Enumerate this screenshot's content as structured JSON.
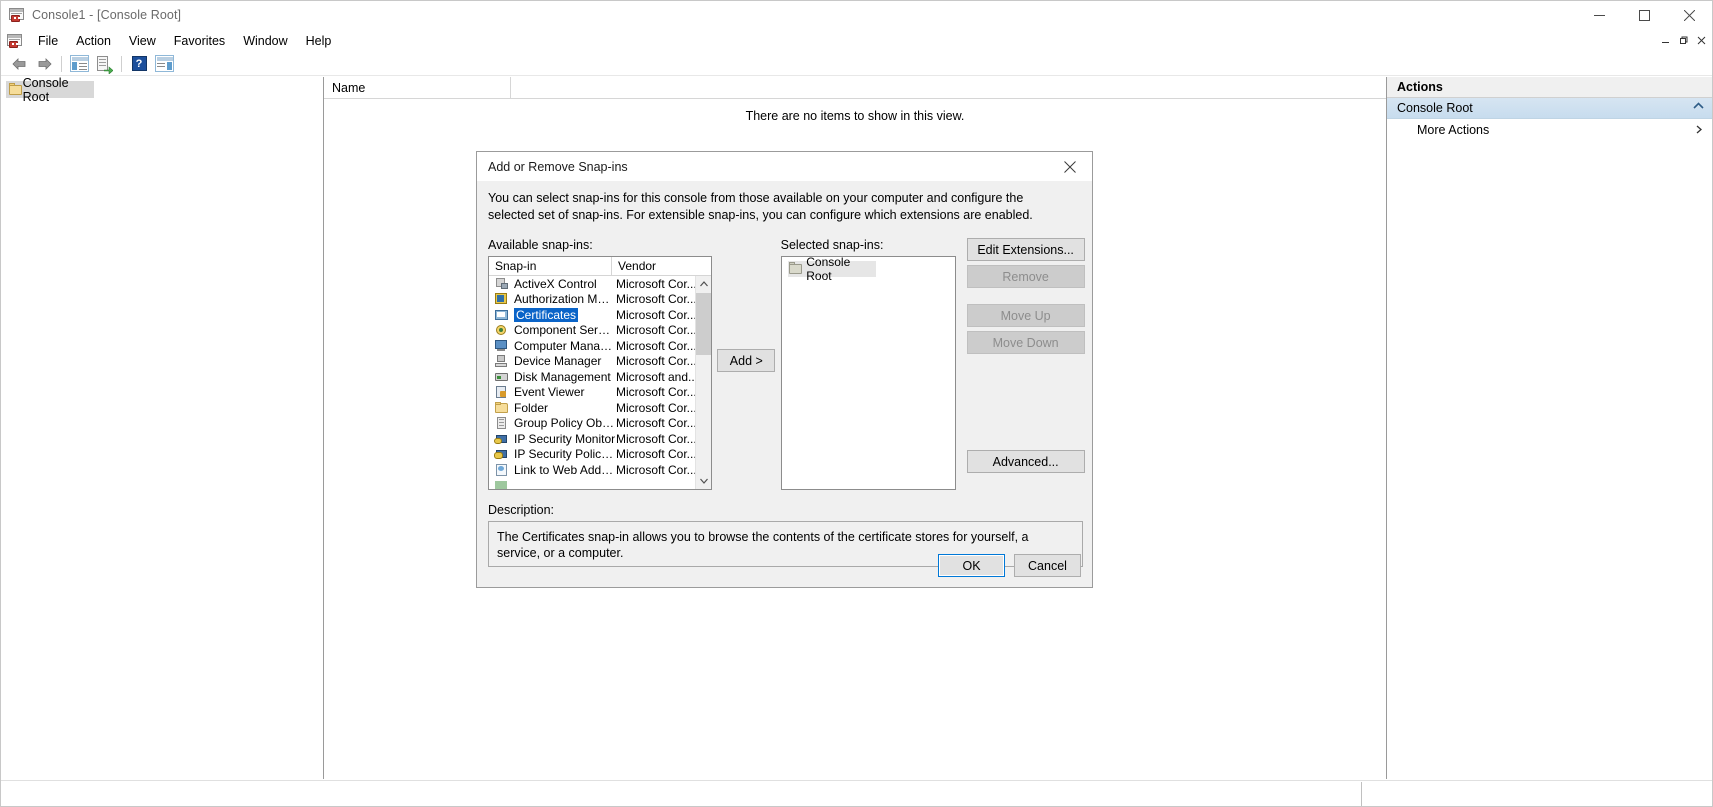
{
  "window": {
    "title": "Console1 - [Console Root]",
    "icon": "mmc-console-icon",
    "controls": {
      "minimize": "─",
      "maximize": "☐",
      "close": "✕"
    }
  },
  "menubar": {
    "items": [
      {
        "label": "File"
      },
      {
        "label": "Action"
      },
      {
        "label": "View"
      },
      {
        "label": "Favorites"
      },
      {
        "label": "Window"
      },
      {
        "label": "Help"
      }
    ],
    "mdi_controls": [
      {
        "name": "mdi-minimize",
        "glyph": "─"
      },
      {
        "name": "mdi-restore",
        "glyph": "❐"
      },
      {
        "name": "mdi-close",
        "glyph": "✕"
      }
    ]
  },
  "toolbar": {
    "buttons": [
      {
        "name": "back-button",
        "icon": "back-arrow-icon"
      },
      {
        "name": "forward-button",
        "icon": "forward-arrow-icon"
      },
      {
        "name": "show-hide-console-tree-button",
        "icon": "console-tree-icon"
      },
      {
        "name": "export-list-button",
        "icon": "export-list-icon"
      },
      {
        "name": "help-button",
        "icon": "question-mark-icon"
      },
      {
        "name": "show-hide-action-pane-button",
        "icon": "action-pane-icon"
      }
    ]
  },
  "tree_pane": {
    "root_node": "Console Root"
  },
  "main_pane": {
    "columns": [
      "Name"
    ],
    "empty_message": "There are no items to show in this view."
  },
  "actions_pane": {
    "header": "Actions",
    "group": "Console Root",
    "items": [
      {
        "label": "More Actions",
        "has_submenu": true
      }
    ]
  },
  "dialog": {
    "title": "Add or Remove Snap-ins",
    "close_label": "✕",
    "intro": "You can select snap-ins for this console from those available on your computer and configure the selected set of snap-ins. For extensible snap-ins, you can configure which extensions are enabled.",
    "available_label": "Available snap-ins:",
    "selected_label": "Selected snap-ins:",
    "available_columns": [
      "Snap-in",
      "Vendor"
    ],
    "available_items": [
      {
        "name": "ActiveX Control",
        "vendor": "Microsoft Cor...",
        "icon": "activex-icon",
        "selected": false
      },
      {
        "name": "Authorization Manager",
        "vendor": "Microsoft Cor...",
        "icon": "authorization-manager-icon",
        "selected": false
      },
      {
        "name": "Certificates",
        "vendor": "Microsoft Cor...",
        "icon": "certificates-icon",
        "selected": true
      },
      {
        "name": "Component Services",
        "vendor": "Microsoft Cor...",
        "icon": "component-services-icon",
        "selected": false
      },
      {
        "name": "Computer Managem...",
        "vendor": "Microsoft Cor...",
        "icon": "computer-management-icon",
        "selected": false
      },
      {
        "name": "Device Manager",
        "vendor": "Microsoft Cor...",
        "icon": "device-manager-icon",
        "selected": false
      },
      {
        "name": "Disk Management",
        "vendor": "Microsoft and...",
        "icon": "disk-management-icon",
        "selected": false
      },
      {
        "name": "Event Viewer",
        "vendor": "Microsoft Cor...",
        "icon": "event-viewer-icon",
        "selected": false
      },
      {
        "name": "Folder",
        "vendor": "Microsoft Cor...",
        "icon": "folder-icon",
        "selected": false
      },
      {
        "name": "Group Policy Object ...",
        "vendor": "Microsoft Cor...",
        "icon": "group-policy-object-icon",
        "selected": false
      },
      {
        "name": "IP Security Monitor",
        "vendor": "Microsoft Cor...",
        "icon": "ip-security-monitor-icon",
        "selected": false
      },
      {
        "name": "IP Security Policy M...",
        "vendor": "Microsoft Cor...",
        "icon": "ip-security-policy-icon",
        "selected": false
      },
      {
        "name": "Link to Web Address",
        "vendor": "Microsoft Cor...",
        "icon": "link-to-web-address-icon",
        "selected": false
      }
    ],
    "add_button": "Add >",
    "selected_items": [
      {
        "name": "Console Root",
        "icon": "folder-icon"
      }
    ],
    "side_buttons": [
      {
        "name": "edit-extensions-button",
        "label": "Edit Extensions...",
        "disabled": false
      },
      {
        "name": "remove-button",
        "label": "Remove",
        "disabled": true
      },
      {
        "name": "move-up-button",
        "label": "Move Up",
        "disabled": true
      },
      {
        "name": "move-down-button",
        "label": "Move Down",
        "disabled": true
      },
      {
        "name": "advanced-button",
        "label": "Advanced...",
        "disabled": false
      }
    ],
    "description_label": "Description:",
    "description_text": "The Certificates snap-in allows you to browse the contents of the certificate stores for yourself, a service, or a computer.",
    "ok_button": "OK",
    "cancel_button": "Cancel"
  },
  "colors": {
    "selection_blue": "#0a64c8",
    "actions_group": "#ccdeee",
    "dialog_bg": "#f0f0f0",
    "focus_border": "#0078d7"
  }
}
